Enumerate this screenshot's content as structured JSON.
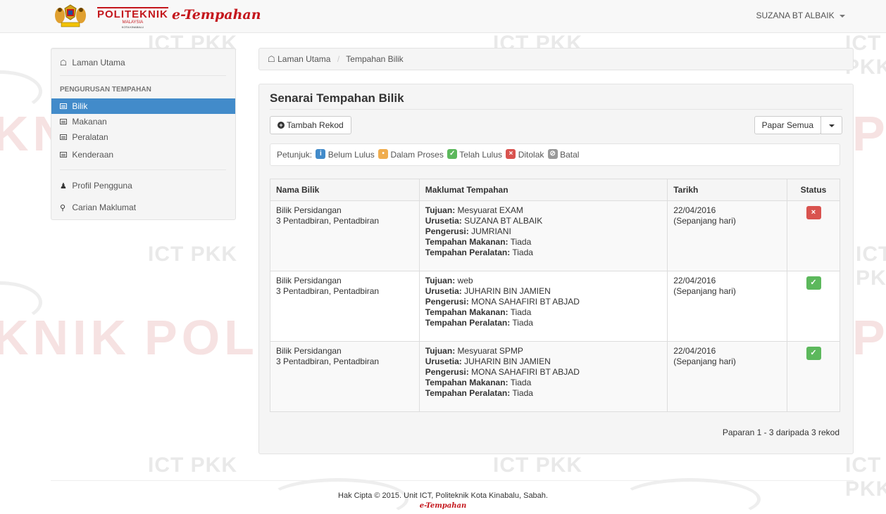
{
  "navbar": {
    "logo_line1": "POLITEKNIK",
    "logo_line2": "MALAYSIA",
    "logo_line3": "KOTA KINABALU",
    "brand": "e-Tempahan",
    "user_name": "SUZANA BT ALBAIK"
  },
  "sidebar": {
    "home": "Laman Utama",
    "section_header": "PENGURUSAN TEMPAHAN",
    "items": [
      {
        "label": "Bilik",
        "active": true
      },
      {
        "label": "Makanan",
        "active": false
      },
      {
        "label": "Peralatan",
        "active": false
      },
      {
        "label": "Kenderaan",
        "active": false
      }
    ],
    "profile": "Profil Pengguna",
    "search": "Carian Maklumat"
  },
  "breadcrumb": {
    "home": "Laman Utama",
    "current": "Tempahan Bilik"
  },
  "panel": {
    "title": "Senarai Tempahan Bilik",
    "add_button": "Tambah Rekod",
    "filter_button": "Papar Semua",
    "legend": {
      "label": "Petunjuk:",
      "items": [
        "Belum Lulus",
        "Dalam Proses",
        "Telah Lulus",
        "Ditolak",
        "Batal"
      ]
    },
    "table": {
      "headers": [
        "Nama Bilik",
        "Maklumat Tempahan",
        "Tarikh",
        "Status"
      ],
      "field_labels": {
        "tujuan": "Tujuan:",
        "urusetia": "Urusetia:",
        "pengerusi": "Pengerusi:",
        "makanan": "Tempahan Makanan:",
        "peralatan": "Tempahan Peralatan:"
      },
      "rows": [
        {
          "room": "Bilik Persidangan",
          "location": "3 Pentadbiran, Pentadbiran",
          "tujuan": "Mesyuarat EXAM",
          "urusetia": "SUZANA BT ALBAIK",
          "pengerusi": "JUMRIANI",
          "makanan": "Tiada",
          "peralatan": "Tiada",
          "date": "22/04/2016",
          "time": "(Sepanjang hari)",
          "status": "Ditolak"
        },
        {
          "room": "Bilik Persidangan",
          "location": "3 Pentadbiran, Pentadbiran",
          "tujuan": "web",
          "urusetia": "JUHARIN BIN JAMIEN",
          "pengerusi": "MONA SAHAFIRI BT ABJAD",
          "makanan": "Tiada",
          "peralatan": "Tiada",
          "date": "22/04/2016",
          "time": "(Sepanjang hari)",
          "status": "Telah Lulus"
        },
        {
          "room": "Bilik Persidangan",
          "location": "3 Pentadbiran, Pentadbiran",
          "tujuan": "Mesyuarat SPMP",
          "urusetia": "JUHARIN BIN JAMIEN",
          "pengerusi": "MONA SAHAFIRI BT ABJAD",
          "makanan": "Tiada",
          "peralatan": "Tiada",
          "date": "22/04/2016",
          "time": "(Sepanjang hari)",
          "status": "Telah Lulus"
        }
      ]
    },
    "pagination_info": "Paparan 1 - 3 daripada 3 rekod"
  },
  "footer": {
    "copyright": "Hak Cipta © 2015. Unit ICT, Politeknik Kota Kinabalu, Sabah.",
    "brand": "e-Tempahan"
  },
  "watermark": {
    "ict": "ICT PKK",
    "pol": "POL",
    "nik": "KNIK"
  },
  "colors": {
    "brand_red": "#c4161c",
    "active_blue": "#428bca",
    "status_rejected": "#d9534f",
    "status_approved": "#5cb85c",
    "status_pending": "#428bca",
    "status_in_process": "#f0ad4e",
    "status_cancelled": "#999999"
  }
}
